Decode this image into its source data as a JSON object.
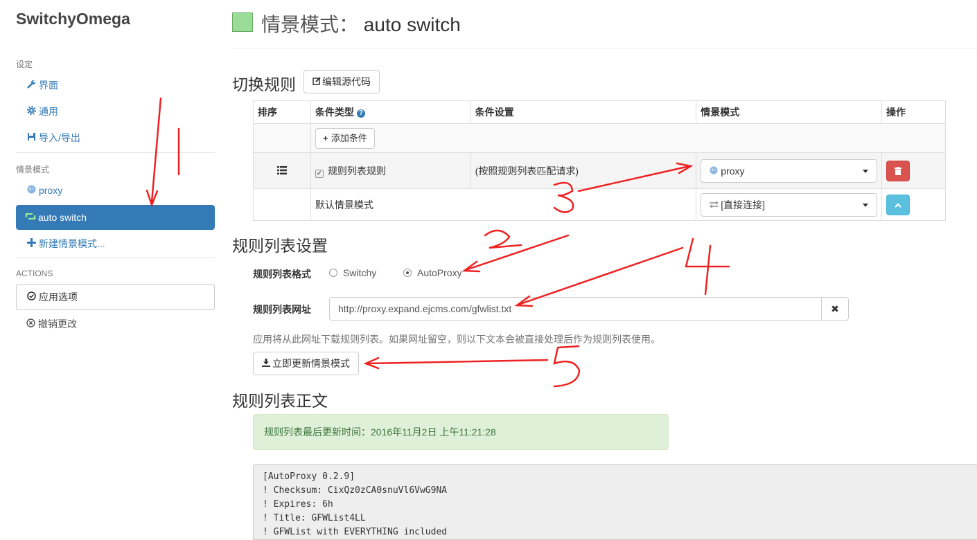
{
  "sidebar": {
    "brand": "SwitchyOmega",
    "settings_header": "设定",
    "settings_items": [
      {
        "label": "界面",
        "icon": "wrench-icon"
      },
      {
        "label": "通用",
        "icon": "gear-icon"
      },
      {
        "label": "导入/导出",
        "icon": "floppy-icon"
      }
    ],
    "profiles_header": "情景模式",
    "profile_items": [
      {
        "label": "proxy",
        "icon": "globe-icon"
      },
      {
        "label": "auto switch",
        "icon": "retweet-icon",
        "active": true
      },
      {
        "label": "新建情景模式...",
        "icon": "plus-icon"
      }
    ],
    "actions_header": "ACTIONS",
    "apply_label": "应用选项",
    "discard_label": "撤销更改"
  },
  "page": {
    "title_prefix": "情景模式：",
    "title_name": "auto switch",
    "swatch_color": "#99dd99"
  },
  "switch_rules": {
    "heading": "切换规则",
    "edit_source_label": "编辑源代码",
    "columns": [
      "排序",
      "条件类型",
      "条件设置",
      "情景模式",
      "操作"
    ],
    "add_condition_label": "添加条件",
    "rule": {
      "condition_type": "规则列表规则",
      "condition_setting": "(按照规则列表匹配请求)",
      "profile": "proxy"
    },
    "default_row": {
      "label": "默认情景模式",
      "profile": "[直接连接]"
    }
  },
  "rule_list_settings": {
    "heading": "规则列表设置",
    "format_label": "规则列表格式",
    "format_options": [
      "Switchy",
      "AutoProxy"
    ],
    "format_selected": "AutoProxy",
    "url_label": "规则列表网址",
    "url_value": "http://proxy.expand.ejcms.com/gfwlist.txt",
    "help_text": "应用将从此网址下载规则列表。如果网址留空，则以下文本会被直接处理后作为规则列表使用。",
    "update_label": "立即更新情景模式"
  },
  "rule_list_text": {
    "heading": "规则列表正文",
    "last_updated": "规则列表最后更新时间：2016年11月2日 上午11:21:28",
    "lines": [
      "[AutoProxy 0.2.9]",
      "! Checksum: CixQz0zCA0snuVl6VwG9NA",
      "! Expires: 6h",
      "! Title: GFWList4LL",
      "! GFWList with EVERYTHING included"
    ]
  },
  "colors": {
    "primary": "#337ab7",
    "danger": "#d9534f",
    "info": "#5bc0de",
    "success_bg": "#dff0d8",
    "annotation": "#ee2222"
  }
}
